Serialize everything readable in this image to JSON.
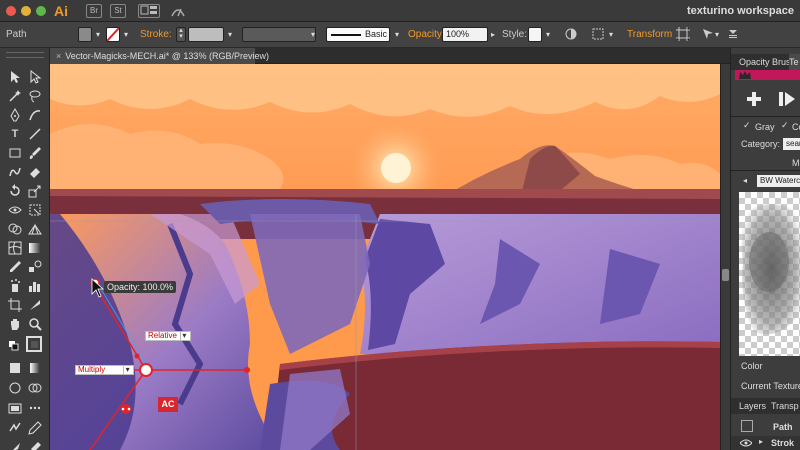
{
  "app": {
    "logo": "Ai",
    "bridge_btn": "Br",
    "stock_btn": "St",
    "workspace": "texturino workspace"
  },
  "control_bar": {
    "selection_type": "Path",
    "stroke_label": "Stroke:",
    "brush_label": "Basic",
    "opacity_label": "Opacity:",
    "opacity_value": "100%",
    "style_label": "Style:",
    "transform_label": "Transform"
  },
  "document": {
    "tab_title": "Vector-Magicks-MECH.ai* @ 133% (RGB/Preview)",
    "tab_close": "×"
  },
  "canvas_overlay": {
    "opacity_tooltip": "Opacity: 100.0%",
    "relative_dropdown": "Relative",
    "multiply_dropdown": "Multiply",
    "ac_badge": "AC"
  },
  "right_panel": {
    "tab_1": "Opacity Brus",
    "tab_2": "Te",
    "gray_label": "Gray",
    "co_label": "Co",
    "category_label": "Category:",
    "category_value": "sean",
    "ma_label": "Ma",
    "texture_name": "BW Waterco",
    "color_label": "Color",
    "current_texture_label": "Current Texture:",
    "layers_tab": "Layers",
    "transp_tab": "Transp",
    "layer_1_name": "Path",
    "layer_2_name": "Strok"
  },
  "colors": {
    "accent": "#f09a2a",
    "selection": "#d9262e",
    "panel_pink": "#c2185b"
  }
}
